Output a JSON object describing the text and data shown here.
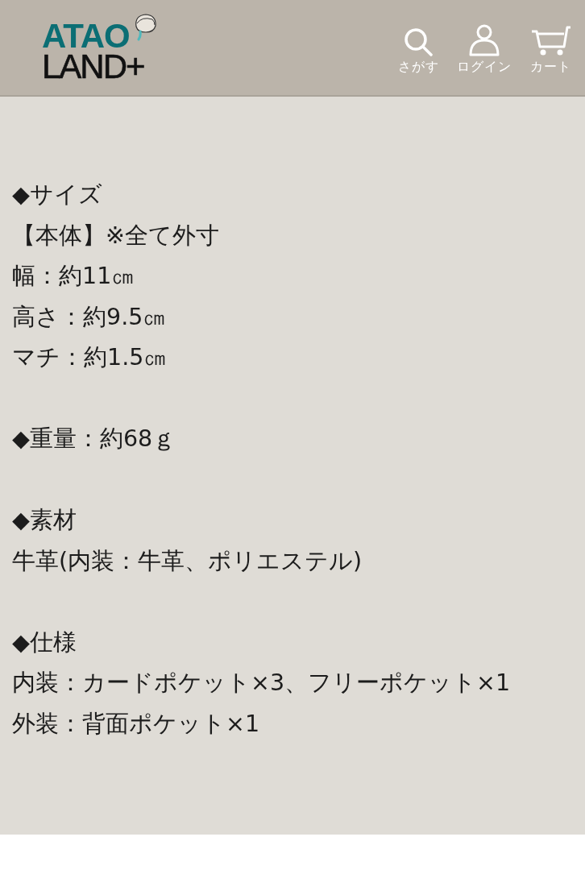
{
  "header": {
    "logo": {
      "top": "ATAO",
      "bottom": "LAND+"
    },
    "nav": [
      {
        "kind": "search",
        "label": "さがす"
      },
      {
        "kind": "login",
        "label": "ログイン"
      },
      {
        "kind": "cart",
        "label": "カート"
      }
    ]
  },
  "sections": [
    {
      "lines": [
        "◆サイズ",
        "【本体】※全て外寸",
        "幅：約11㎝",
        "高さ：約9.5㎝",
        "マチ：約1.5㎝"
      ]
    },
    {
      "lines": [
        "◆重量：約68ｇ"
      ]
    },
    {
      "lines": [
        "◆素材",
        "牛革(内装：牛革、ポリエステル)"
      ]
    },
    {
      "lines": [
        "◆仕様",
        "内装：カードポケット×3、フリーポケット×1",
        "外装：背面ポケット×1"
      ]
    }
  ]
}
